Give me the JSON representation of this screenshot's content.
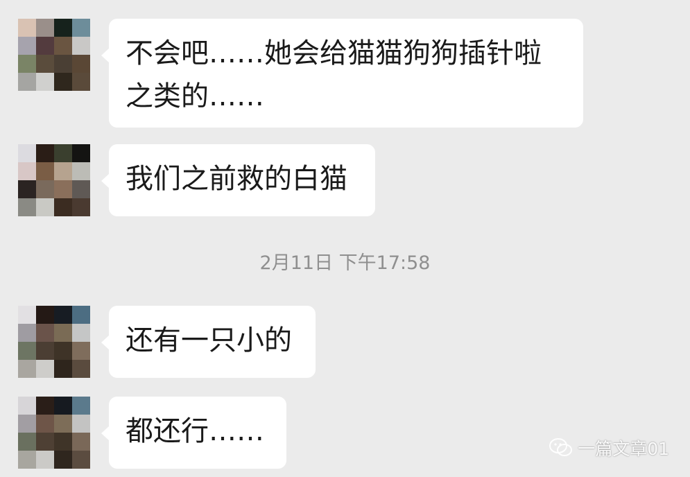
{
  "chat": {
    "messages": [
      {
        "text": "不会吧……她会给猫猫狗狗插针啦\n之类的……",
        "avatar_colors": [
          "#d9c2b3",
          "#9a8f8a",
          "#16221c",
          "#6d8d9a",
          "#a6a3ad",
          "#533b3e",
          "#6a5541",
          "#c9c8c6",
          "#7a8466",
          "#5a4c3c",
          "#4a3f34",
          "#5a4735",
          "#a5a5a2",
          "#d0d0ce",
          "#2f271d",
          "#5a4a3a"
        ]
      },
      {
        "text": "我们之前救的白猫",
        "avatar_colors": [
          "#dcdbe0",
          "#2a1d16",
          "#3a3f2e",
          "#141412",
          "#d8c7c6",
          "#7a5d45",
          "#b6a38f",
          "#bcbcb6",
          "#2b2422",
          "#7a6a5c",
          "#8a6f5b",
          "#5f5955",
          "#8a8a84",
          "#c9c9c4",
          "#3b2c21",
          "#4a3a30"
        ]
      },
      {
        "text": "还有一只小的",
        "avatar_colors": [
          "#e2e0e3",
          "#241915",
          "#171c23",
          "#4c6d82",
          "#9f9ca2",
          "#6a534a",
          "#7a6b55",
          "#c5c6c6",
          "#6d7563",
          "#4b3e33",
          "#3e3327",
          "#7f6d5c",
          "#a9a6a0",
          "#cecdca",
          "#2e251c",
          "#5a4b3e"
        ]
      },
      {
        "text": "都还行……",
        "avatar_colors": [
          "#d7d5d8",
          "#2a1e18",
          "#161a20",
          "#5b7a8c",
          "#a29ea3",
          "#6e5548",
          "#7d6d58",
          "#c3c3c2",
          "#6a705f",
          "#4e4034",
          "#3f3428",
          "#7a6858",
          "#a8a69f",
          "#cbcac7",
          "#2f261e",
          "#5b4c40"
        ]
      }
    ],
    "timestamp": "2月11日 下午17:58"
  },
  "watermark": {
    "icon": "wechat-icon",
    "text": "一篇文章01"
  }
}
